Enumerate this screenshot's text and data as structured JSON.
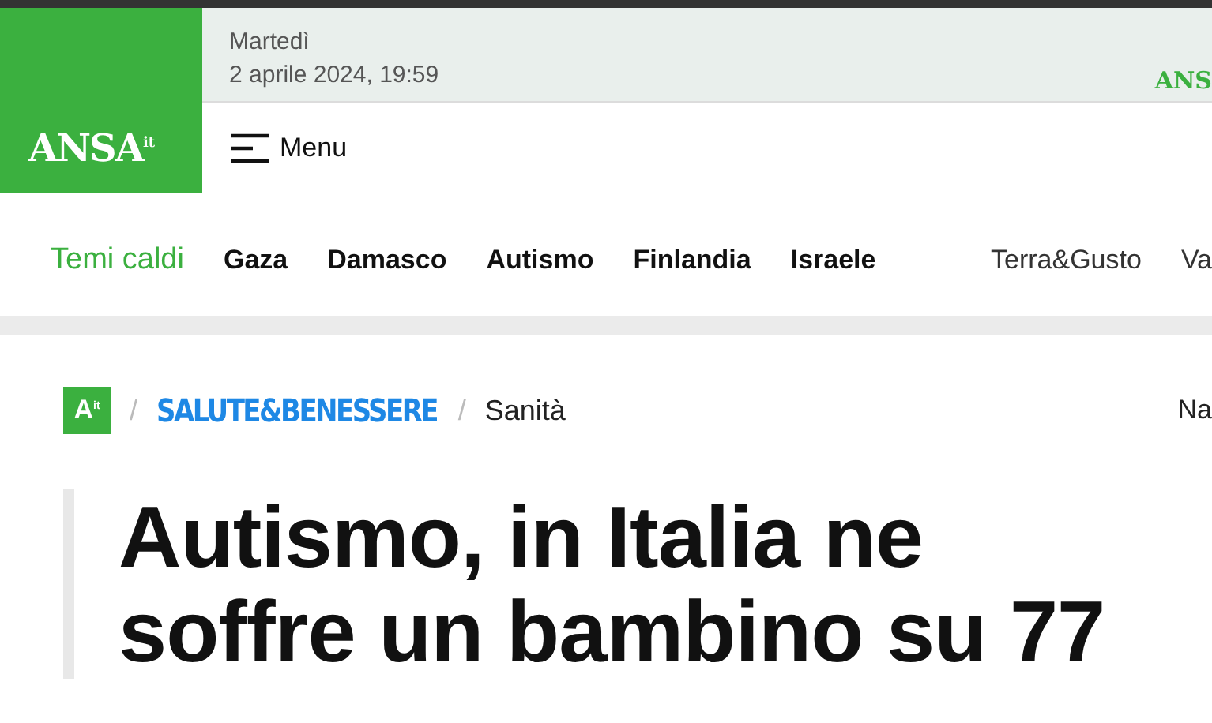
{
  "logo": {
    "name": "ANSA",
    "suffix": "it"
  },
  "date": {
    "weekday": "Martedì",
    "datetime": "2 aprile 2024, 19:59"
  },
  "right_logo": {
    "text": "ANS"
  },
  "menu": {
    "label": "Menu"
  },
  "hot_topics": {
    "label": "Temi caldi",
    "items": [
      "Gaza",
      "Damasco",
      "Autismo",
      "Finlandia",
      "Israele"
    ],
    "extra": [
      "Terra&Gusto",
      "Va"
    ]
  },
  "breadcrumb": {
    "separators": [
      "/",
      "/"
    ],
    "home_logo": {
      "letter": "A",
      "suffix": "it"
    },
    "section": "SALUTE&BENESSERE",
    "subsection": "Sanità",
    "right": "Na"
  },
  "article": {
    "headline_lines": [
      "Autismo, in Italia ne",
      "soffre un bambino su 77"
    ]
  }
}
